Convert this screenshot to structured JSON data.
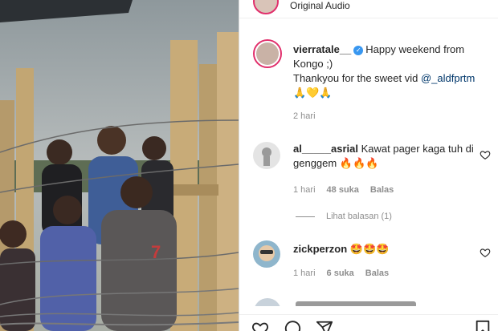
{
  "post": {
    "audio_label": "Original Audio",
    "caption": {
      "username": "vierratale__",
      "text_line1": "Happy weekend from Kongo ;)",
      "text_line2_prefix": "Thankyou for the sweet vid ",
      "mention": "@_aldfprtm",
      "emojis": "🙏💛🙏",
      "time": "2 hari"
    }
  },
  "comments": [
    {
      "username": "al_____asrial",
      "text": "Kawat pager kaga tuh di genggem 🔥🔥🔥",
      "time": "1 hari",
      "likes": "48 suka",
      "reply_label": "Balas",
      "view_replies": "Lihat balasan (1)"
    },
    {
      "username": "zickperzon",
      "text": "🤩🤩🤩",
      "time": "1 hari",
      "likes": "6 suka",
      "reply_label": "Balas"
    }
  ],
  "colors": {
    "verified": "#3897f0",
    "mention": "#00376b",
    "story_ring": "#e1306c"
  },
  "icons": [
    "verified-icon",
    "heart-icon",
    "comment-icon",
    "share-icon",
    "bookmark-icon"
  ]
}
